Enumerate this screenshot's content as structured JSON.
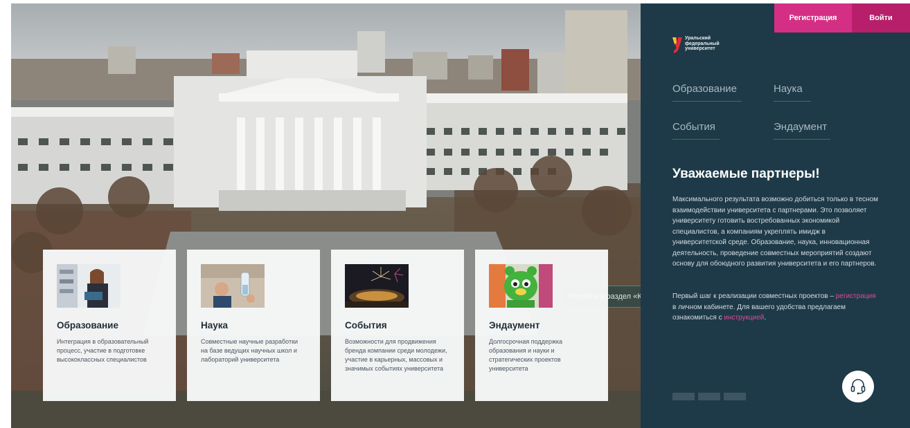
{
  "header": {
    "register_label": "Регистрация",
    "login_label": "Войти"
  },
  "logo": {
    "line1": "Уральский",
    "line2": "федеральный",
    "line3": "университет"
  },
  "nav": {
    "items": [
      {
        "label": "Образование"
      },
      {
        "label": "Наука"
      },
      {
        "label": "События"
      },
      {
        "label": "Эндаумент"
      }
    ]
  },
  "hero": {
    "caption": "Перейти в раздел «Картинки»"
  },
  "cards": [
    {
      "title": "Образование",
      "desc": "Интеграция в образовательный процесс, участие в подготовке высококлассных специалистов",
      "image": "student-reading-photo"
    },
    {
      "title": "Наука",
      "desc": "Совместные научные разработки на базе ведущих научных школ и лабораторий университета",
      "image": "lab-scientist-photo"
    },
    {
      "title": "События",
      "desc": "Возможности для продвижения бренда компании среди молодежи, участие в карьерных, массовых и значимых событиях университета",
      "image": "fireworks-photo"
    },
    {
      "title": "Эндаумент",
      "desc": "Долгосрочная поддержка образования и науки и стратегических проектов университета",
      "image": "mascot-bear-photo"
    }
  ],
  "content": {
    "heading": "Уважаемые партнеры!",
    "para1": "Максимального результата возможно добиться только в тесном взаимодействии университета с партнерами. Это позволяет университету готовить востребованных экономикой специалистов, а компаниям укреплять имидж в университетской среде. Образование, наука, инновационная деятельность, проведение совместных мероприятий создают основу для обоюдного развития университета и его партнеров.",
    "para2_before": "Первый шаг к реализации совместных проектов – ",
    "para2_link1": "регистрация",
    "para2_middle": " в личном кабинете. Для вашего удобства предлагаем ознакомиться с ",
    "para2_link2": "инструкцией",
    "para2_after": "."
  },
  "icons": {
    "support": "headset-icon"
  },
  "colors": {
    "sidebar": "#1e3a48",
    "accent": "#d52f85",
    "accent_dark": "#b71f6b",
    "link": "#e3479b"
  }
}
